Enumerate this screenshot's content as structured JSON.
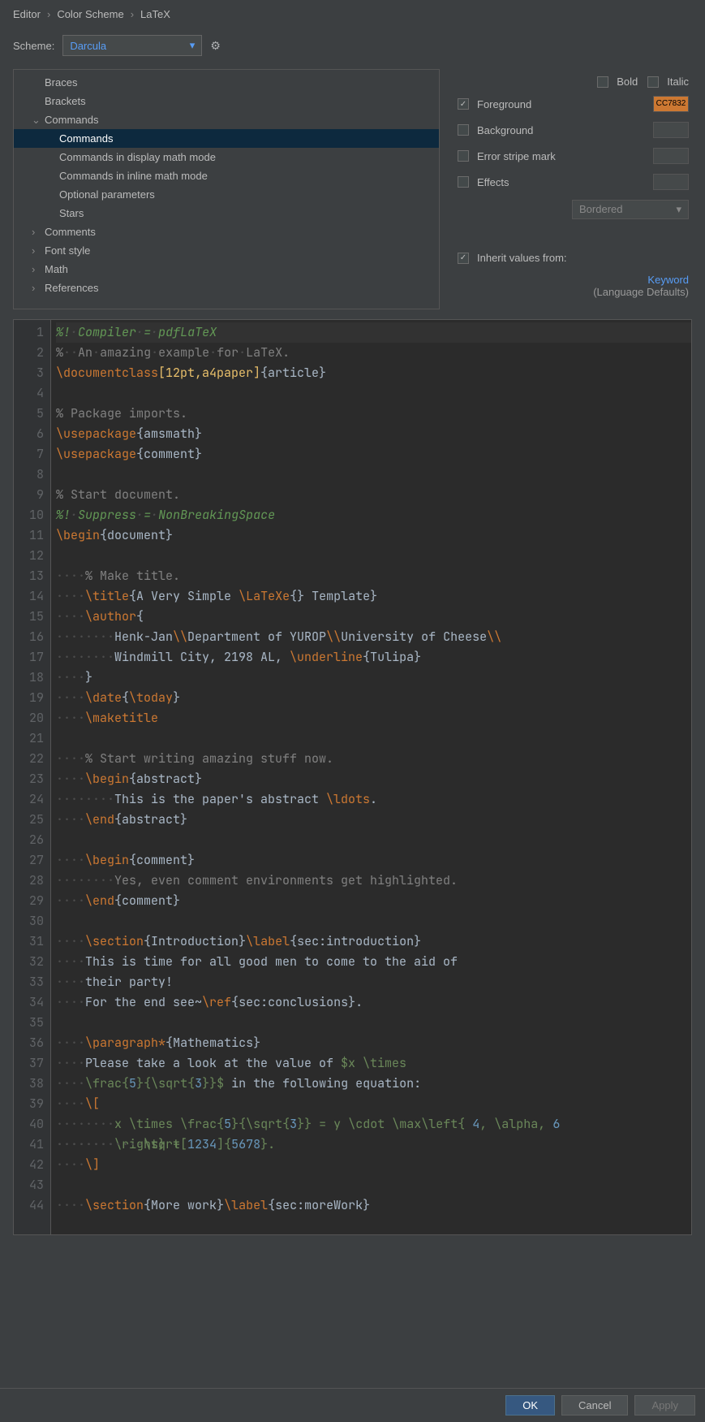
{
  "breadcrumb": [
    "Editor",
    "Color Scheme",
    "LaTeX"
  ],
  "scheme": {
    "label": "Scheme:",
    "value": "Darcula"
  },
  "tree": {
    "items": [
      {
        "label": "Braces",
        "type": "leaf"
      },
      {
        "label": "Brackets",
        "type": "leaf"
      },
      {
        "label": "Commands",
        "type": "expanded",
        "children": [
          {
            "label": "Commands",
            "selected": true
          },
          {
            "label": "Commands in display math mode"
          },
          {
            "label": "Commands in inline math mode"
          },
          {
            "label": "Optional parameters"
          },
          {
            "label": "Stars"
          }
        ]
      },
      {
        "label": "Comments",
        "type": "expandable"
      },
      {
        "label": "Font style",
        "type": "expandable"
      },
      {
        "label": "Math",
        "type": "expandable"
      },
      {
        "label": "References",
        "type": "expandable"
      }
    ]
  },
  "style_panel": {
    "bold": "Bold",
    "italic": "Italic",
    "foreground": {
      "label": "Foreground",
      "checked": true,
      "color": "#CC7832",
      "hex": "CC7832"
    },
    "background": {
      "label": "Background",
      "checked": false
    },
    "error_stripe": {
      "label": "Error stripe mark",
      "checked": false
    },
    "effects": {
      "label": "Effects",
      "checked": false,
      "value": "Bordered"
    },
    "inherit": {
      "label": "Inherit values from:",
      "checked": true,
      "link": "Keyword",
      "sub": "(Language Defaults)"
    }
  },
  "footer": {
    "ok": "OK",
    "cancel": "Cancel",
    "apply": "Apply"
  }
}
